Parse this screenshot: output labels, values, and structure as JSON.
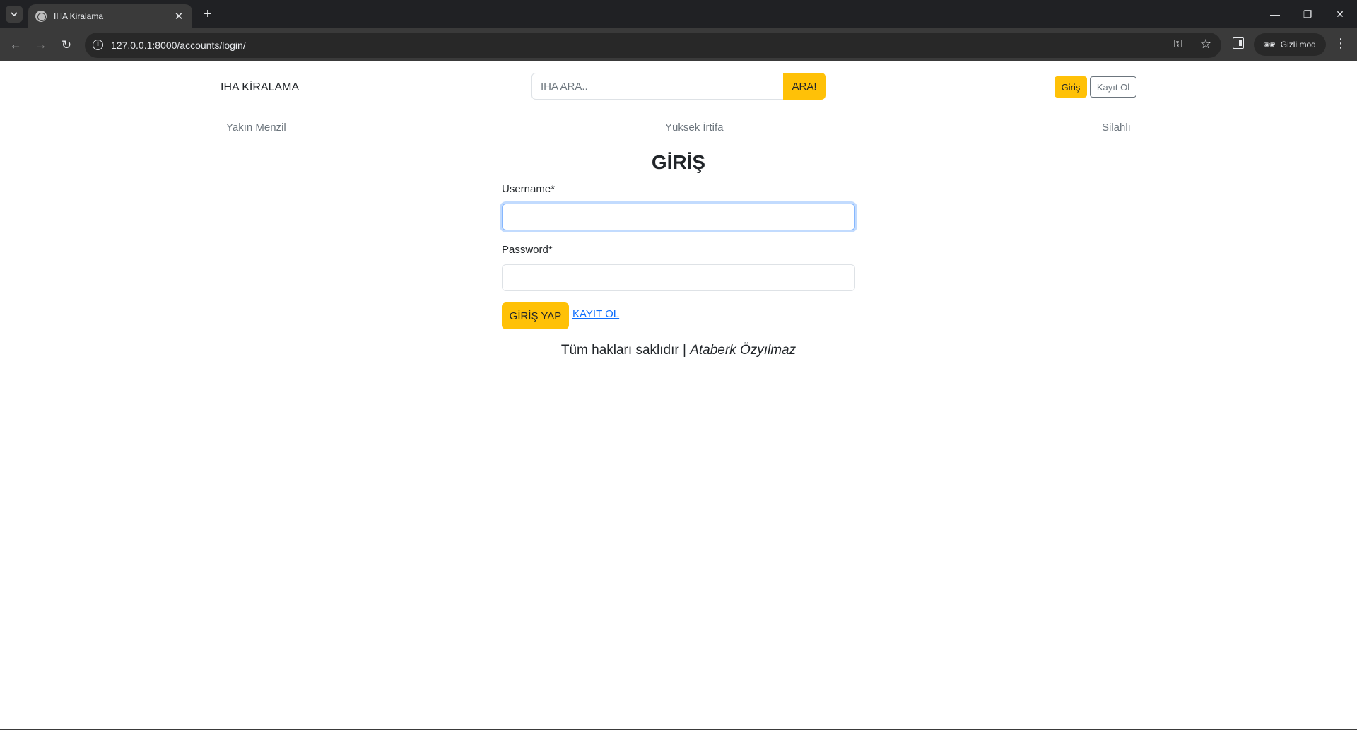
{
  "browser": {
    "tab_title": "IHA Kiralama",
    "url": "127.0.0.1:8000/accounts/login/",
    "incognito_label": "Gizli mod",
    "icons": {
      "tab_list": "chevron-down-icon",
      "favicon": "globe-icon",
      "tab_close": "close-icon",
      "new_tab": "plus-icon",
      "back": "back-arrow-icon",
      "forward": "forward-arrow-icon",
      "reload": "reload-icon",
      "site_info": "info-icon",
      "password_key": "key-icon",
      "bookmark": "star-icon",
      "side_panel": "side-panel-icon",
      "incognito": "incognito-icon",
      "menu": "more-vert-icon"
    }
  },
  "header": {
    "brand": "IHA KİRALAMA",
    "search_placeholder": "IHA ARA..",
    "search_button": "ARA!",
    "login_button": "Giriş",
    "register_button": "Kayıt Ol"
  },
  "categories": [
    "Yakın Menzil",
    "Yüksek İrtifa",
    "Silahlı"
  ],
  "login_form": {
    "title": "GİRİŞ",
    "username_label": "Username*",
    "username_value": "",
    "password_label": "Password*",
    "password_value": "",
    "submit_button": "GİRİŞ YAP",
    "register_link": "KAYIT OL"
  },
  "footer": {
    "text": "Tüm hakları saklıdır | ",
    "author": "Ataberk Özyılmaz"
  },
  "colors": {
    "accent": "#ffc107",
    "link": "#0d6efd",
    "muted": "#6c757d",
    "browser_bg": "#202124"
  }
}
